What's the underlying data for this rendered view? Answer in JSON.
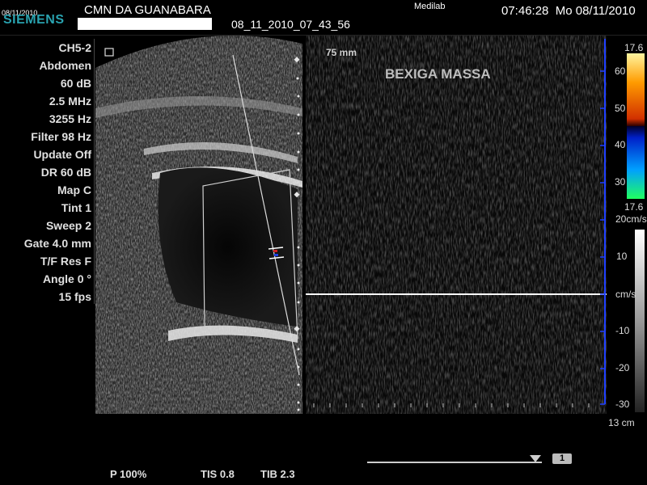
{
  "header": {
    "tiny_date": "08/11/2010",
    "brand": "SIEMENS",
    "institution": "CMN DA GUANABARA",
    "exam_id": "08_11_2010_07_43_56",
    "site": "Medilab",
    "time": "07:46:28",
    "date": "Mo  08/11/2010"
  },
  "params": [
    "CH5-2",
    "Abdomen",
    "60 dB",
    "2.5 MHz",
    "3255 Hz",
    "Filter 98 Hz",
    "Update Off",
    "DR 60 dB",
    "Map C",
    "Tint 1",
    "Sweep 2",
    "Gate 4.0 mm",
    "T/F Res F",
    "Angle 0 °",
    "15 fps"
  ],
  "image": {
    "depth_label": "75 mm",
    "annotation": "BEXIGA MASSA",
    "scale_depth": "13 cm"
  },
  "color_scale": {
    "top": "17.6",
    "labels": [
      "60",
      "50",
      "40",
      "30"
    ],
    "bottom": "17.6",
    "colors": {
      "warm": "#ff9b00",
      "cool": "#00a0ff",
      "brand": "#29a3b0"
    }
  },
  "velocity_scale": {
    "unit_top": "20",
    "unit_top_suffix": "cm/s",
    "ticks": [
      "10",
      "cm/s",
      "-10",
      "-20",
      "-30"
    ]
  },
  "footer": {
    "power": "P 100%",
    "tis": "TIS 0.8",
    "tib": "TIB 2.3",
    "page": "1"
  }
}
